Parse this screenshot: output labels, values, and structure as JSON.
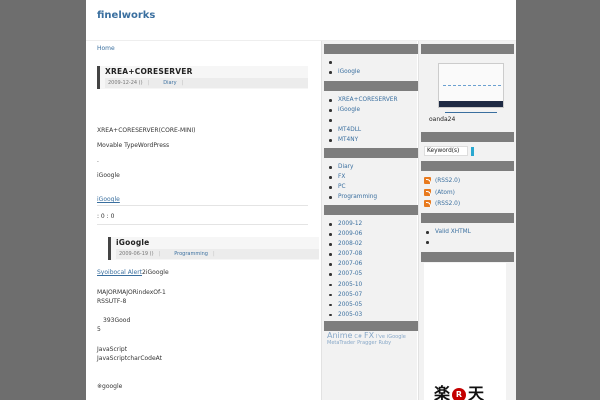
{
  "site": {
    "title": "finelworks"
  },
  "breadcrumb": {
    "home": "Home"
  },
  "entry1": {
    "title": "XREA+CORESERVER",
    "date": "2009-12-24 ()",
    "category": "Diary",
    "lines": [
      "XREA+CORESERVER(CORE-MINI)",
      "Movable TypeWordPress",
      ".",
      "iGoogle"
    ],
    "link": "iGoogle",
    "counts": ": 0      : 0"
  },
  "entry2": {
    "title": "iGoogle",
    "date": "2009-06-19 ()",
    "category": "Programming",
    "link": "Syoibocal Alert",
    "link_suffix": "2iGoogle",
    "lines": [
      "MAJORMAJORindexOf-1",
      "RSSUTF-8",
      "393Good",
      "5",
      "JavaScript",
      "JavaScriptcharCodeAt",
      "※google"
    ]
  },
  "col2": {
    "list1": [
      "",
      "iGoogle"
    ],
    "list2": [
      "XREA+CORESERVER",
      "iGoogle",
      "",
      "MT4DLL",
      "MT4NY"
    ],
    "categories": [
      "Diary",
      "FX",
      "PC",
      "Programming"
    ],
    "archives": [
      "2009-12",
      "2009-06",
      "2008-02",
      "2007-08",
      "2007-06",
      "2007-05",
      "2005-10",
      "2005-07",
      "2005-05",
      "2005-03"
    ],
    "tags": [
      {
        "text": "Anime",
        "size": "big"
      },
      {
        "text": "C#",
        "size": "sml"
      },
      {
        "text": "FX",
        "size": "big"
      },
      {
        "text": "I've",
        "size": "sml"
      },
      {
        "text": "iGoogle",
        "size": "sml"
      },
      {
        "text": "MetaTrader",
        "size": "sml"
      },
      {
        "text": "Pragger",
        "size": "sml"
      },
      {
        "text": "Ruby",
        "size": "sml"
      }
    ]
  },
  "col3": {
    "caption": "oanda24",
    "search_label": "Keyword(s)",
    "feeds": [
      "(RSS2.0)",
      "(Atom)",
      "(RSS2.0)"
    ],
    "links": [
      "Valid XHTML",
      ""
    ],
    "banner": {
      "left": "楽",
      "mark": "R",
      "right": "天"
    }
  },
  "colors": {
    "link": "#3a6f9f",
    "bar": "#7d7d7d",
    "outer": "#6e6e6e",
    "feed": "#e87a1e",
    "button": "#2aa8d0",
    "rakuten": "#c40000"
  }
}
